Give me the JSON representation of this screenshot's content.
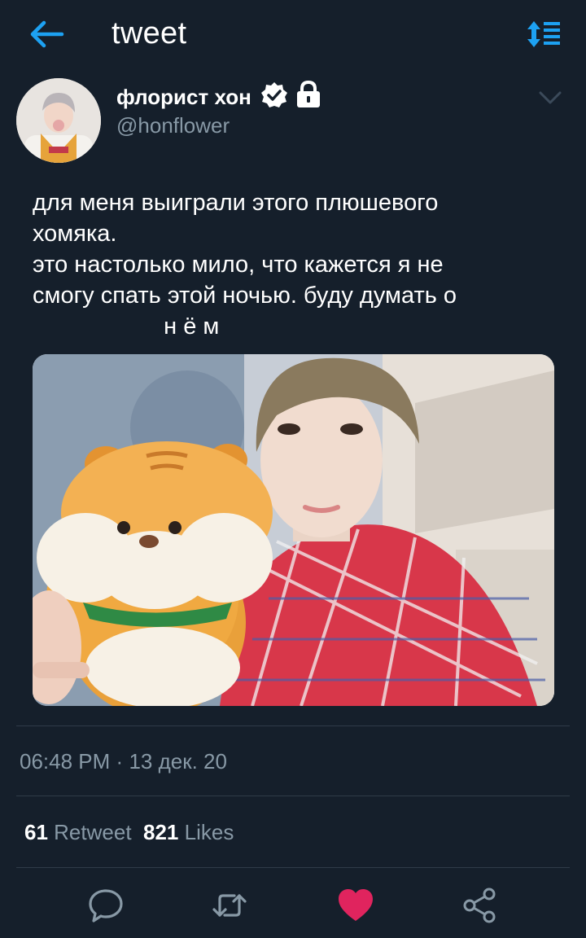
{
  "header": {
    "title": "tweet",
    "back_icon": "arrow-left-icon",
    "sort_icon": "sort-arrows-icon",
    "accent_color": "#1da1f2"
  },
  "author": {
    "name": "флорист хон",
    "handle": "@honflower",
    "verified": true,
    "protected": true
  },
  "tweet": {
    "text_lines": [
      "для меня выиграли этого плюшевого",
      "хомяка.",
      "это настолько мило, что кажется я не",
      "смогу спать этой ночью. буду думать о",
      "                    н ё м"
    ],
    "time": "06:48 PM",
    "separator": "·",
    "date": "13 дек. 20"
  },
  "stats": {
    "retweets": "61",
    "retweets_label": "Retweet",
    "likes": "821",
    "likes_label": "Likes"
  },
  "actions": {
    "reply_icon": "reply-bubble-icon",
    "retweet_icon": "retweet-icon",
    "like_icon": "heart-icon",
    "share_icon": "share-icon",
    "liked": true,
    "like_color": "#e0245e"
  }
}
